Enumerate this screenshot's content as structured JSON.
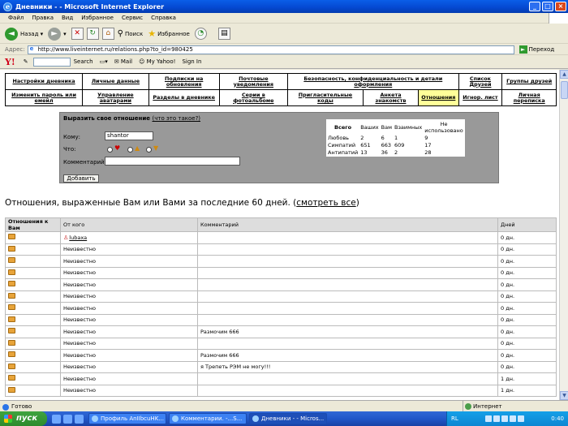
{
  "window": {
    "title": "Дневники - - Microsoft Internet Explorer",
    "btn_min": "_",
    "btn_max": "□",
    "btn_close": "×"
  },
  "menu": [
    "Файл",
    "Правка",
    "Вид",
    "Избранное",
    "Сервис",
    "Справка"
  ],
  "toolbar": {
    "back": "Назад",
    "search": "Поиск",
    "favorites": "Избранное"
  },
  "address": {
    "label": "Адрес:",
    "url": "http://www.liveinternet.ru/relations.php?to_id=980425",
    "go": "Переход"
  },
  "yahoo": {
    "logo": "Y!",
    "search": "Search",
    "mail": "Mail",
    "my_yahoo": "My Yahoo!",
    "signin": "Sign In"
  },
  "nav": {
    "row1": [
      "Настройки дневника",
      "Личные данные",
      "Подписки на обновления",
      "Почтовые уведомления",
      "Безопасность, конфиденциальность и детали оформления",
      "Список Друзей",
      "Группы друзей"
    ],
    "row2": [
      "Изменить пароль или емейл",
      "Управление аватарами",
      "Разделы в дневнике",
      "Серии в фотоальбоме",
      "Пригласительные коды",
      "Анкета знакомств",
      "Отношения",
      "Игнор. лист",
      "Личная переписка"
    ]
  },
  "form": {
    "title": "Выразить свое отношение",
    "title_link": "(что это такое?)",
    "to_label": "Кому:",
    "to_value": "shantor",
    "what_label": "Что:",
    "comment_label": "Комментарий:",
    "comment_value": "",
    "submit": "Добавить"
  },
  "stats": {
    "headers": [
      "Всего",
      "Ваших",
      "Вам",
      "Взаимных",
      "Не использовано"
    ],
    "rows": [
      [
        "Любовь",
        "2",
        "6",
        "1",
        "9"
      ],
      [
        "Симпатий",
        "651",
        "663",
        "609",
        "17"
      ],
      [
        "Антипатий",
        "13",
        "36",
        "2",
        "28"
      ]
    ]
  },
  "heading": {
    "text": "Отношения, выраженные Вам или Вами за последние 60 дней. (",
    "link": "смотреть все",
    "close": ")"
  },
  "relations": {
    "headers": [
      "Отношения к Вам",
      "От кого",
      "Комментарий",
      "Дней"
    ],
    "rows": [
      {
        "from": "lubaxa",
        "comment": "",
        "days": "0 дн.",
        "user": true
      },
      {
        "from": "Неизвестно",
        "comment": "",
        "days": "0 дн."
      },
      {
        "from": "Неизвестно",
        "comment": "",
        "days": "0 дн."
      },
      {
        "from": "Неизвестно",
        "comment": "",
        "days": "0 дн."
      },
      {
        "from": "Неизвестно",
        "comment": "",
        "days": "0 дн."
      },
      {
        "from": "Неизвестно",
        "comment": "",
        "days": "0 дн."
      },
      {
        "from": "Неизвестно",
        "comment": "",
        "days": "0 дн."
      },
      {
        "from": "Неизвестно",
        "comment": "",
        "days": "0 дн."
      },
      {
        "from": "Неизвестно",
        "comment": "Размочим 666",
        "days": "0 дн."
      },
      {
        "from": "Неизвестно",
        "comment": "",
        "days": "0 дн."
      },
      {
        "from": "Неизвестно",
        "comment": "Размочим 666",
        "days": "0 дн."
      },
      {
        "from": "Неизвестно",
        "comment": "я Трепеть РЭМ не могу!!!",
        "days": "0 дн."
      },
      {
        "from": "Неизвестно",
        "comment": "",
        "days": "1 дн."
      },
      {
        "from": "Неизвестно",
        "comment": "",
        "days": "1 дн."
      }
    ]
  },
  "status": {
    "text": "Готово",
    "zone": "Интернет"
  },
  "taskbar": {
    "start": "пуск",
    "tasks": [
      "Профиль AnIIbcuHK...",
      "Комментарии. -...S...",
      "Дневники - - Micros..."
    ],
    "lang": "RL",
    "clock": "0:40"
  }
}
